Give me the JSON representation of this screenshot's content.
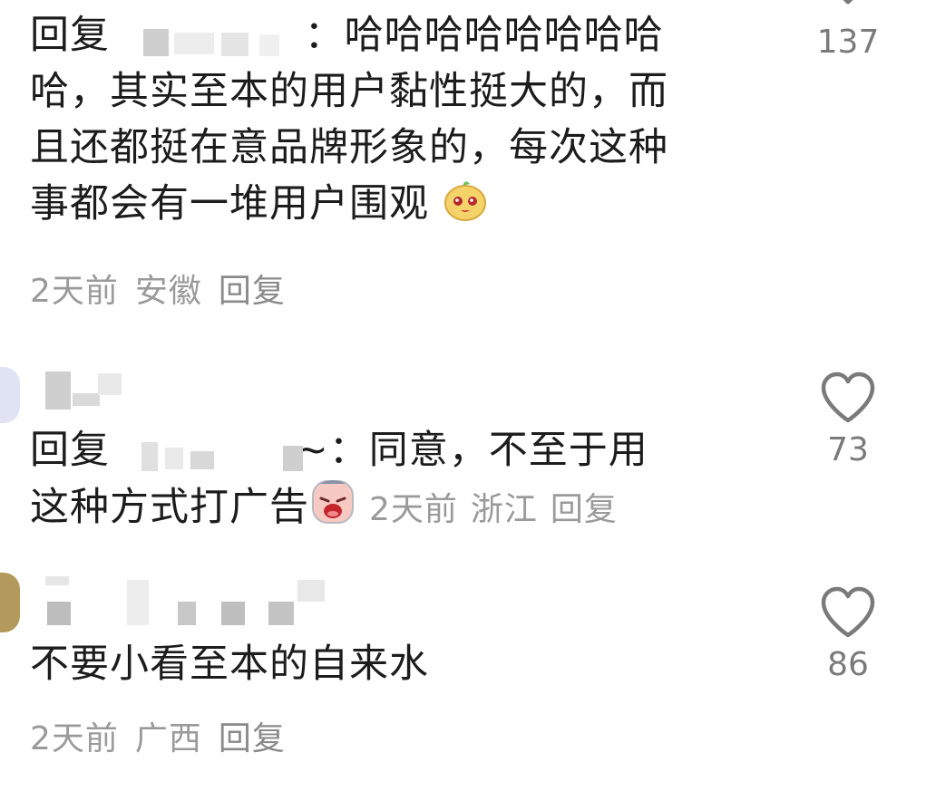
{
  "comments": [
    {
      "reply_prefix": "回复",
      "reply_sep": "：",
      "text_l1": "哈哈哈哈哈哈哈哈",
      "text_l2": "哈，其实至本的用户黏性挺大的，而",
      "text_l3": "且还都挺在意品牌形象的，每次这种",
      "text_l4": "事都会有一堆用户围观",
      "emoji": "smiling-face-emoji",
      "time": "2天前",
      "location": "安徽",
      "reply_label": "回复",
      "likes": "137"
    },
    {
      "reply_prefix": "回复",
      "reply_tail": "~：",
      "text_l1": "同意，不至于用",
      "text_l2": "这种方式打广告",
      "emoji": "crying-face-emoji",
      "time": "2天前",
      "location": "浙江",
      "reply_label": "回复",
      "likes": "73"
    },
    {
      "text": "不要小看至本的自来水",
      "time": "2天前",
      "location": "广西",
      "reply_label": "回复",
      "likes": "86"
    }
  ],
  "colors": {
    "text": "#1c1c1c",
    "meta": "#9a9a9a",
    "like_icon": "#7a7a7a"
  }
}
